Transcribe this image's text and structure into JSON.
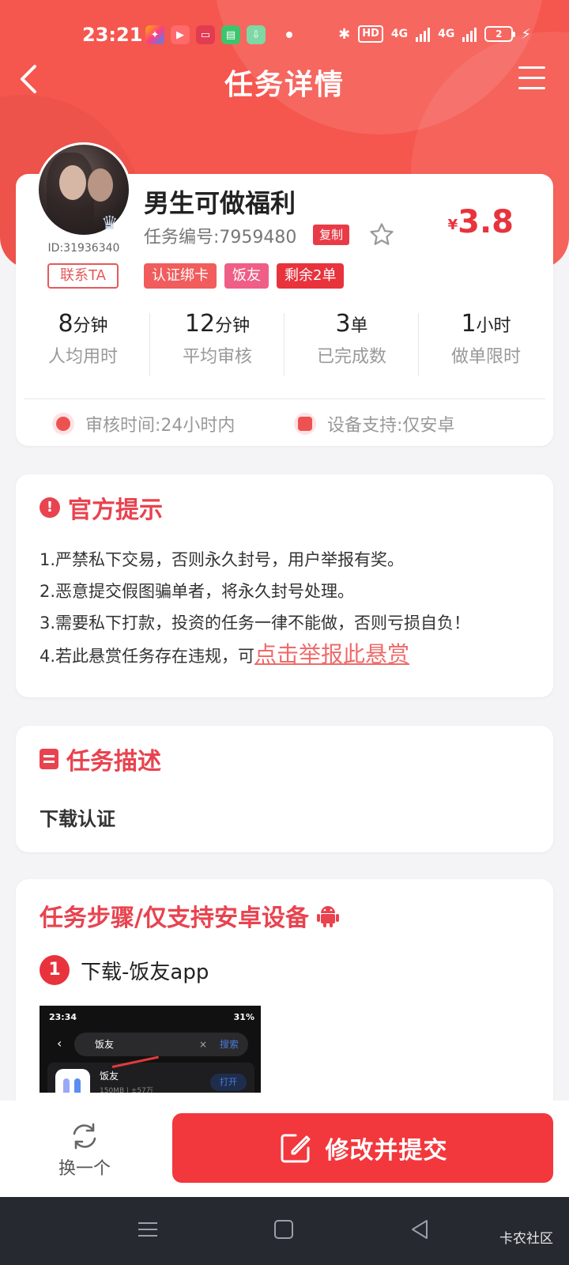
{
  "status_bar": {
    "time": "23:21",
    "hd_label": "HD",
    "net1": "4G",
    "net2": "4G",
    "battery": "2"
  },
  "nav": {
    "title": "任务详情"
  },
  "task": {
    "title": "男生可做福利",
    "number_label": "任务编号:7959480",
    "copy_label": "复制",
    "price_currency": "¥",
    "price_value": "3.8",
    "user_id": "ID:31936340",
    "contact_label": "联系TA",
    "crown_text": "月卡",
    "tags": [
      "认证绑卡",
      "饭友",
      "剩余2单"
    ],
    "tag_colors": [
      "#f15c5c",
      "#ef5e87",
      "#e8333d"
    ]
  },
  "stats": [
    {
      "value": "8",
      "unit": "分钟",
      "label": "人均用时"
    },
    {
      "value": "12",
      "unit": "分钟",
      "label": "平均审核"
    },
    {
      "value": "3",
      "unit": "单",
      "label": "已完成数"
    },
    {
      "value": "1",
      "unit": "小时",
      "label": "做单限时"
    }
  ],
  "meta": {
    "review_time": "审核时间:24小时内",
    "device_support": "设备支持:仅安卓"
  },
  "notice": {
    "title": "官方提示",
    "rules": [
      "1.严禁私下交易，否则永久封号，用户举报有奖。",
      "2.恶意提交假图骗单者，将永久封号处理。",
      "3.需要私下打款，投资的任务一律不能做，否则亏损自负！"
    ],
    "rule4_prefix": "4.若此悬赏任务存在违规，可",
    "rule4_link": "点击举报此悬赏"
  },
  "description": {
    "title": "任务描述",
    "text": "下载认证"
  },
  "steps": {
    "title": "任务步骤/仅支持安卓设备",
    "items": [
      {
        "num": "1",
        "text": "下载-饭友app"
      }
    ],
    "screenshot": {
      "time": "23:34",
      "battery": "31%",
      "query": "饭友",
      "search_btn": "搜索",
      "clear": "×",
      "app_name": "饭友",
      "app_meta": "150MB | ±57万",
      "open_btn": "打开"
    }
  },
  "actions": {
    "swap_label": "换一个",
    "submit_label": "修改并提交"
  },
  "watermark": "卡农社区",
  "colors": {
    "brand_red": "#f2373d",
    "header_red": "#f5564e",
    "accent_pink": "#e8434f"
  }
}
